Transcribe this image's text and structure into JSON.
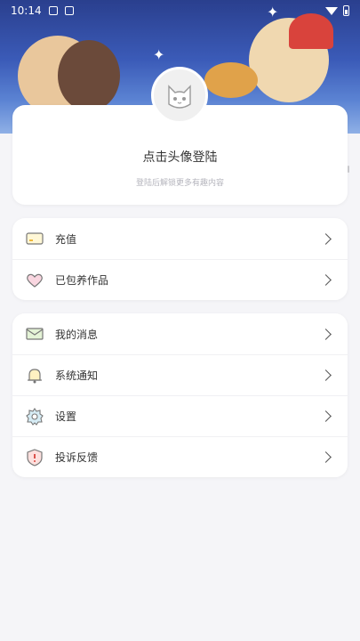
{
  "status_bar": {
    "time": "10:14"
  },
  "profile": {
    "title": "点击头像登陆",
    "subtitle": "登陆后解锁更多有趣内容"
  },
  "group1": [
    {
      "label": "充值",
      "icon": "card-icon"
    },
    {
      "label": "已包养作品",
      "icon": "heart-icon"
    }
  ],
  "group2": [
    {
      "label": "我的消息",
      "icon": "envelope-icon"
    },
    {
      "label": "系统通知",
      "icon": "bell-icon"
    },
    {
      "label": "设置",
      "icon": "settings-icon"
    },
    {
      "label": "投诉反馈",
      "icon": "shield-icon"
    }
  ],
  "colors": {
    "banner": "#3b5bb8",
    "background": "#f5f5f8",
    "card": "#ffffff"
  }
}
